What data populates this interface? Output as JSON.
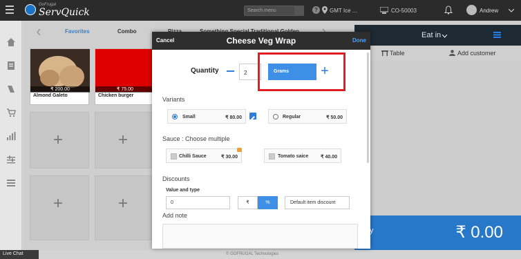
{
  "topbar": {
    "brand_small": "GoFrugal",
    "brand": "ServQuick",
    "search_placeholder": "Search menu",
    "location": "GMT Ice ...",
    "store": "CO-50003",
    "user": "Andrew"
  },
  "tabs": [
    "Favorites",
    "Combo",
    "Pizza",
    "Something Special Traditional Golden..."
  ],
  "tiles": [
    {
      "name": "Almond Galeto",
      "price": "₹ 200.00"
    },
    {
      "name": "Chicken burger",
      "price": "₹ 75.00"
    }
  ],
  "right_panel": {
    "mode": "Eat in",
    "table": "Table",
    "add_customer": "Add customer",
    "total_prefix": "y",
    "total": "₹ 0.00"
  },
  "footer": {
    "live_chat": "Live Chat",
    "copyright": "© GOFRUGAL Technologies"
  },
  "modal": {
    "cancel": "Cancel",
    "title": "Cheese Veg Wrap",
    "done": "Done",
    "quantity_label": "Quantity",
    "quantity_value": "2",
    "unit": "Grams",
    "variants_label": "Variants",
    "variants": [
      {
        "name": "Small",
        "price": "₹ 80.00",
        "selected": true
      },
      {
        "name": "Regular",
        "price": "₹ 50.00",
        "selected": false
      }
    ],
    "sauce_label": "Sauce : Choose multiple",
    "sauces": [
      {
        "name": "Chilli Sauce",
        "price": "₹ 30.00"
      },
      {
        "name": "Tomato saice",
        "price": "₹ 40.00"
      }
    ],
    "discounts_label": "Discounts",
    "value_type_label": "Value and type",
    "discount_value": "0",
    "rupee": "₹",
    "percent": "%",
    "default_discount": "Default item discount",
    "add_note_label": "Add note"
  },
  "colors": {
    "accent": "#3e8fe6",
    "highlight": "#e31b23",
    "header": "#2e2e2e"
  }
}
